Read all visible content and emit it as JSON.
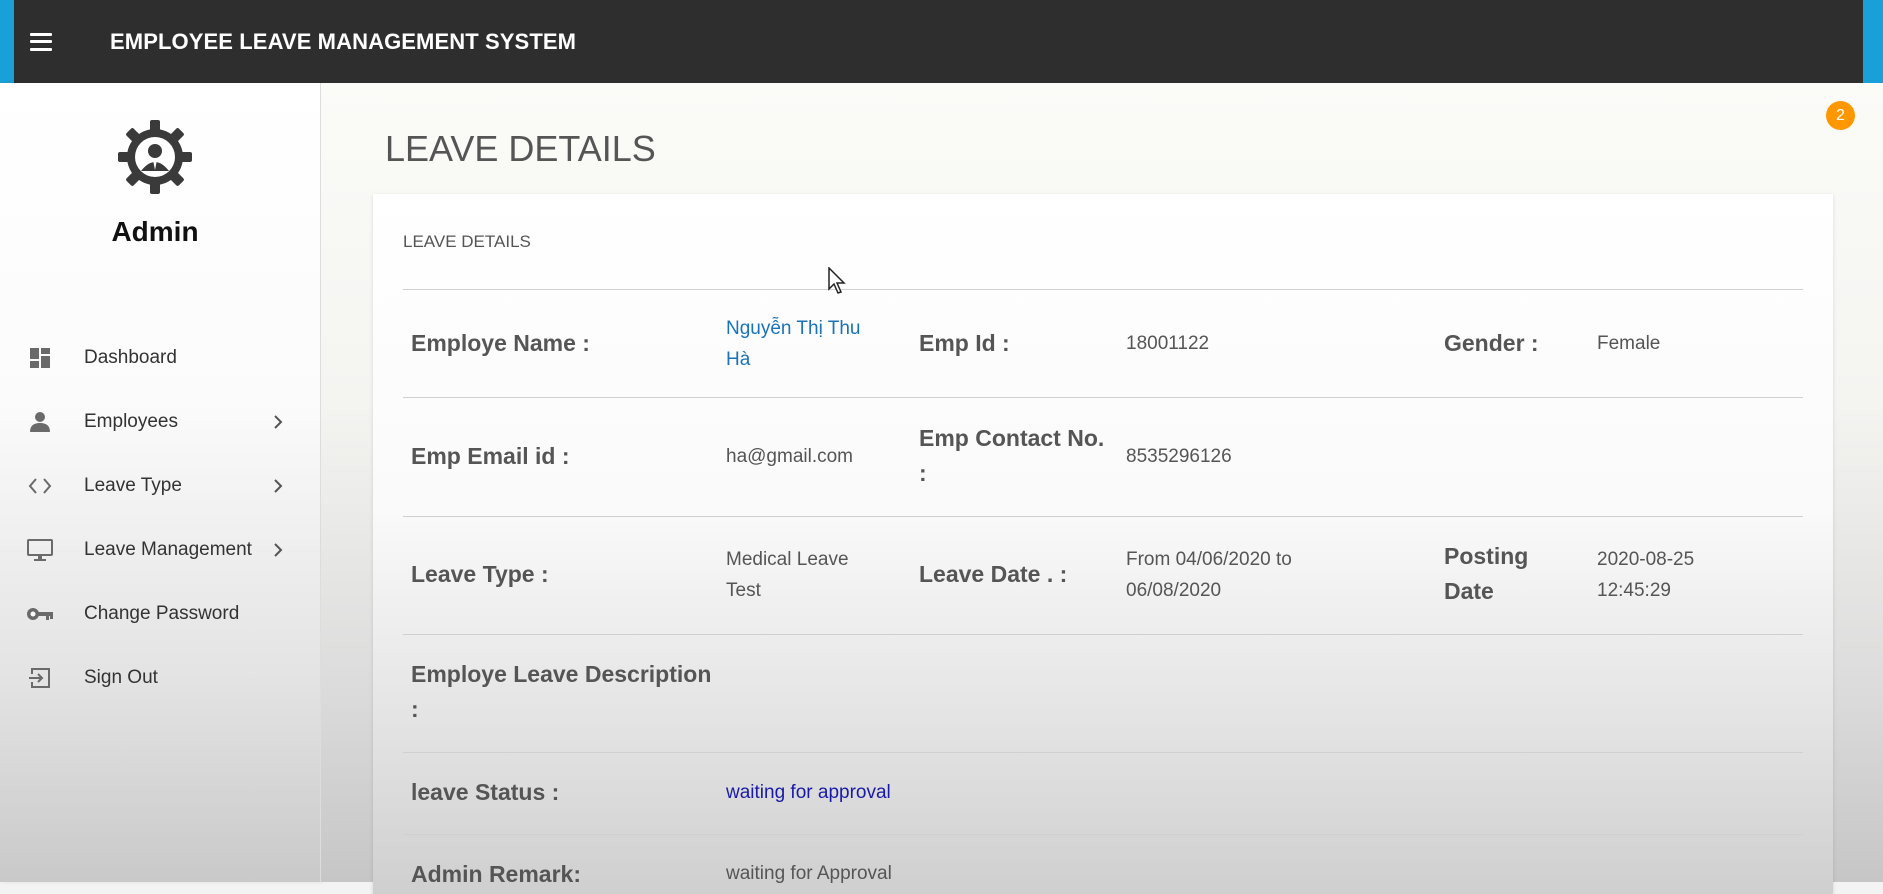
{
  "header": {
    "title": "EMPLOYEE LEAVE MANAGEMENT SYSTEM"
  },
  "sidebar": {
    "profile_name": "Admin",
    "items": [
      {
        "label": "Dashboard",
        "icon": "dashboard-icon",
        "has_submenu": false
      },
      {
        "label": "Employees",
        "icon": "person-icon",
        "has_submenu": true
      },
      {
        "label": "Leave Type",
        "icon": "code-icon",
        "has_submenu": true
      },
      {
        "label": "Leave Management",
        "icon": "monitor-icon",
        "has_submenu": true
      },
      {
        "label": "Change Password",
        "icon": "key-icon",
        "has_submenu": false
      },
      {
        "label": "Sign Out",
        "icon": "sign-out-icon",
        "has_submenu": false
      }
    ]
  },
  "notifications": {
    "count": "2"
  },
  "page": {
    "title": "LEAVE DETAILS",
    "card_title": "LEAVE DETAILS"
  },
  "details": {
    "employee_name_label": "Employe Name :",
    "employee_name": "Nguyễn Thị Thu Hà",
    "emp_id_label": "Emp Id :",
    "emp_id": "18001122",
    "gender_label": "Gender :",
    "gender": "Female",
    "email_label": "Emp Email id :",
    "email": "ha@gmail.com",
    "contact_label": "Emp Contact No. :",
    "contact": "8535296126",
    "leave_type_label": "Leave Type :",
    "leave_type": "Medical Leave Test",
    "leave_date_label": "Leave Date . :",
    "leave_date": "From 04/06/2020 to 06/08/2020",
    "posting_date_label": "Posting Date",
    "posting_date": "2020-08-25 12:45:29",
    "description_label": "Employe Leave Description :",
    "status_label": "leave Status :",
    "status": "waiting for approval",
    "admin_remark_label": "Admin Remark:",
    "admin_remark": "waiting for Approval"
  },
  "colors": {
    "topbar": "#2e2e2e",
    "accent": "#1aa0d8",
    "badge": "#ff9800",
    "name_link": "#1a73b8",
    "status_text": "#1a1aa8"
  }
}
